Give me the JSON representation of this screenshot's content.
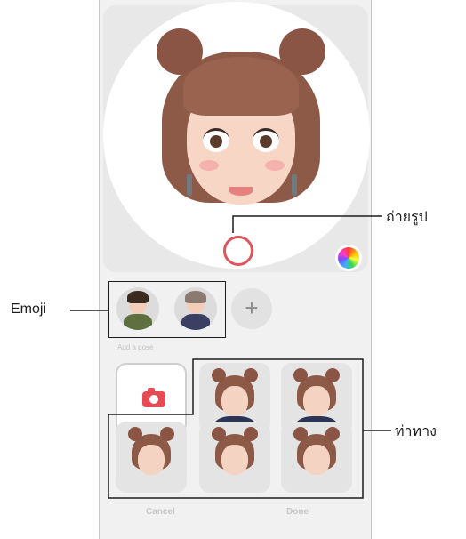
{
  "callouts": {
    "capture_label": "ถ่ายรูป",
    "emoji_label": "Emoji",
    "pose_label": "ท่าทาง"
  },
  "main": {
    "section_label": "Add a pose",
    "emoji_add_symbol": "+"
  },
  "footer": {
    "cancel_label": "Cancel",
    "done_label": "Done"
  },
  "colors": {
    "shutter_ring": "#e0555c",
    "camera_icon": "#e64a55",
    "hair": "#8e5a48"
  },
  "icons": [
    "color-palette-icon",
    "camera-icon",
    "plus-icon"
  ]
}
